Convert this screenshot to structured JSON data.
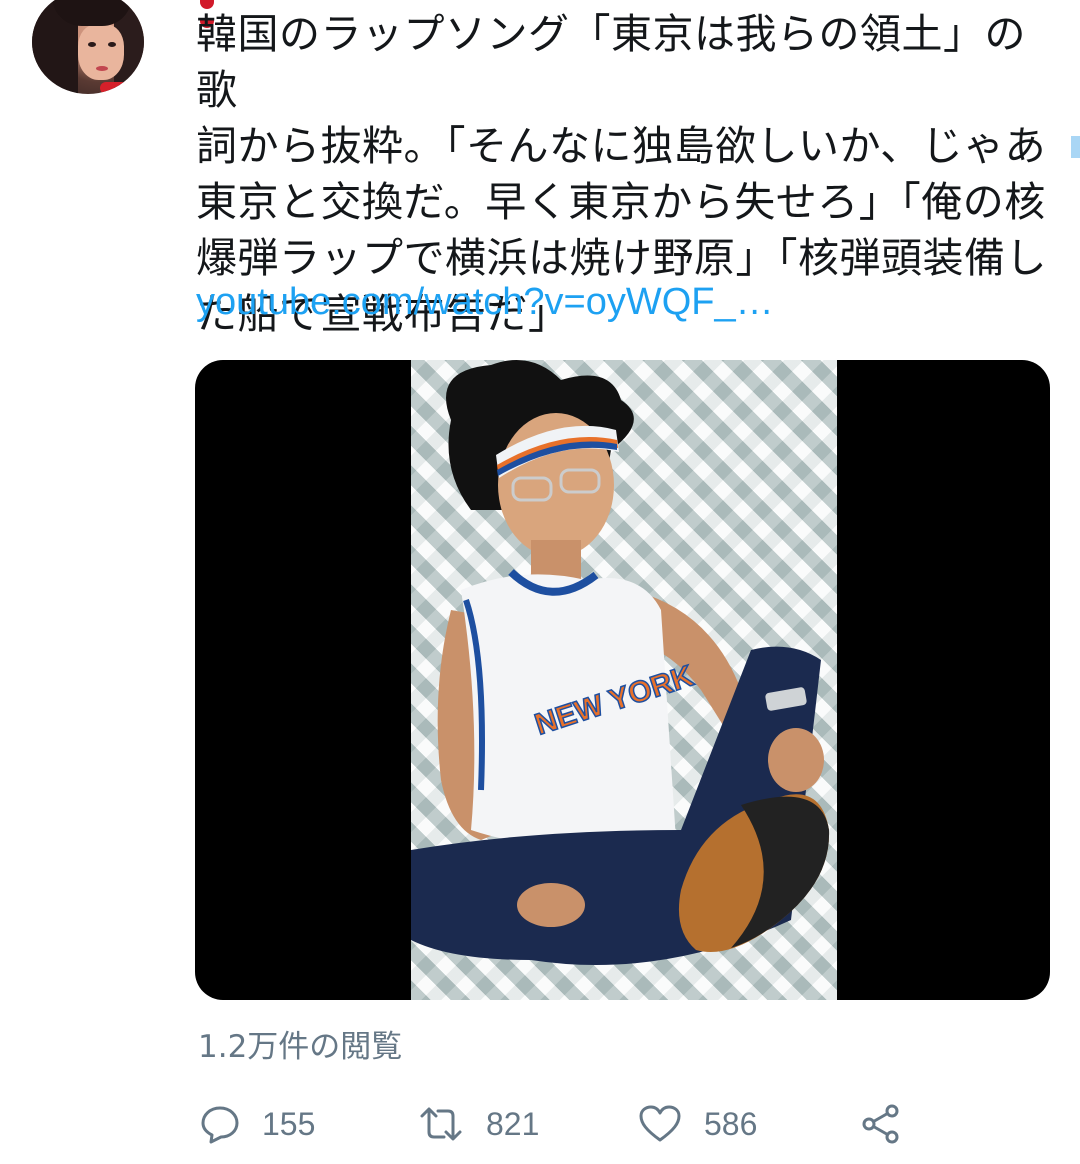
{
  "tweet": {
    "text": "韓国のラップソング「東京は我らの領土」の歌詞から抜粋。「そんなに独島欲しいか、じゃあ東京と交換だ。早く東京から失せろ」「俺の核爆弾ラップで横浜は焼け野原」「核弾頭装備した船で宣戦布告だ」",
    "lines": [
      "韓国のラップソング「東京は我らの領土」の歌",
      "詞から抜粋。「そんなに独島欲しいか、じゃあ",
      "東京と交換だ。早く東京から失せろ」「俺の核",
      "爆弾ラップで横浜は焼け野原」「核弾頭装備し",
      "た船で宣戦布告だ」"
    ],
    "link": "youtube.com/watch?v=oyWQF_…",
    "views": "1.2万件の閲覧"
  },
  "actions": {
    "reply_count": "155",
    "retweet_count": "821",
    "like_count": "586"
  },
  "icons": {
    "reply": "reply-icon",
    "retweet": "retweet-icon",
    "like": "heart-icon",
    "share": "share-icon"
  },
  "colors": {
    "text": "#14171a",
    "link": "#1da1f2",
    "muted": "#657786"
  }
}
